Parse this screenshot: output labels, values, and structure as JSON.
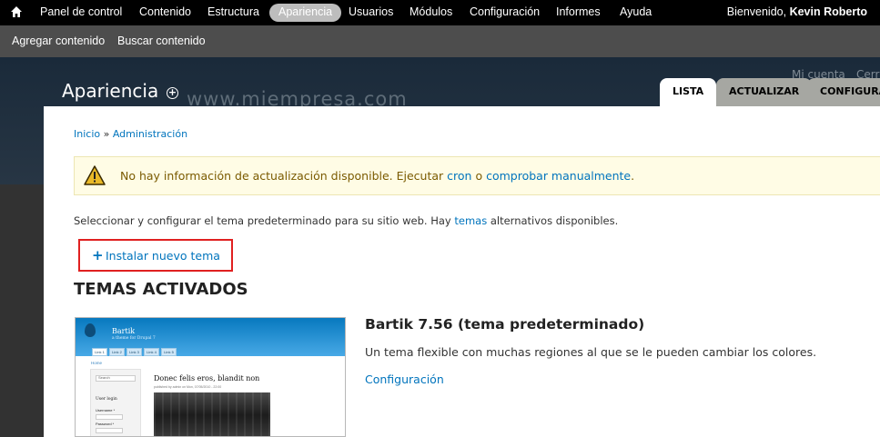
{
  "toolbar": {
    "home_icon": "home-icon",
    "items": [
      "Panel de control",
      "Contenido",
      "Estructura",
      "Apariencia",
      "Usuarios",
      "Módulos",
      "Configuración",
      "Informes",
      "Ayuda"
    ],
    "active_index": 3,
    "welcome_prefix": "Bienvenido, ",
    "user_name": "Kevin Roberto"
  },
  "shortcuts": [
    "Agregar contenido",
    "Buscar contenido"
  ],
  "overlay": {
    "title": "Apariencia",
    "add_shortcut_icon": "plus-circle-icon",
    "watermark": "www.miempresa.com",
    "my_account": "Mi cuenta",
    "logout": "Cerr"
  },
  "tabs": [
    "LISTA",
    "ACTUALIZAR",
    "CONFIGURA"
  ],
  "breadcrumb": {
    "home": "Inicio",
    "separator": " » ",
    "admin": "Administración"
  },
  "warning": {
    "icon": "warning-icon",
    "text_before": "No hay información de actualización disponible. Ejecutar ",
    "cron": "cron",
    "middle": " o ",
    "manual": "comprobar manualmente",
    "end": "."
  },
  "intro": {
    "before": "Seleccionar y configurar el tema predeterminado para su sitio web. Hay ",
    "link": "temas",
    "after": " alternativos disponibles."
  },
  "install": {
    "icon": "plus-icon",
    "label": "Instalar nuevo tema"
  },
  "section_title": "TEMAS ACTIVADOS",
  "thumbnail": {
    "brand": "Bartik",
    "slogan": "a theme for Drupal 7",
    "tabs": [
      "Link 1",
      "Link 2",
      "Link 3",
      "Link 4",
      "Link 5"
    ],
    "home": "Home",
    "search_label": "Search",
    "user_login": "User login",
    "username": "Username *",
    "password": "Password *",
    "article_title": "Donec felis eros, blandit non",
    "byline": "published by admin on Mon, 07/05/2010 - 22:00"
  },
  "theme": {
    "name": "Bartik 7.56 (tema predeterminado)",
    "description": "Un tema flexible con muchas regiones al que se le pueden cambiar los colores.",
    "config": "Configuración"
  },
  "colors": {
    "toolbar_bg": "#000000",
    "shortcuts_bg": "#4d4d4d",
    "link": "#0074bd",
    "warning_bg": "#fffce5",
    "warning_text": "#7a5a00",
    "highlight_border": "#e02020"
  }
}
